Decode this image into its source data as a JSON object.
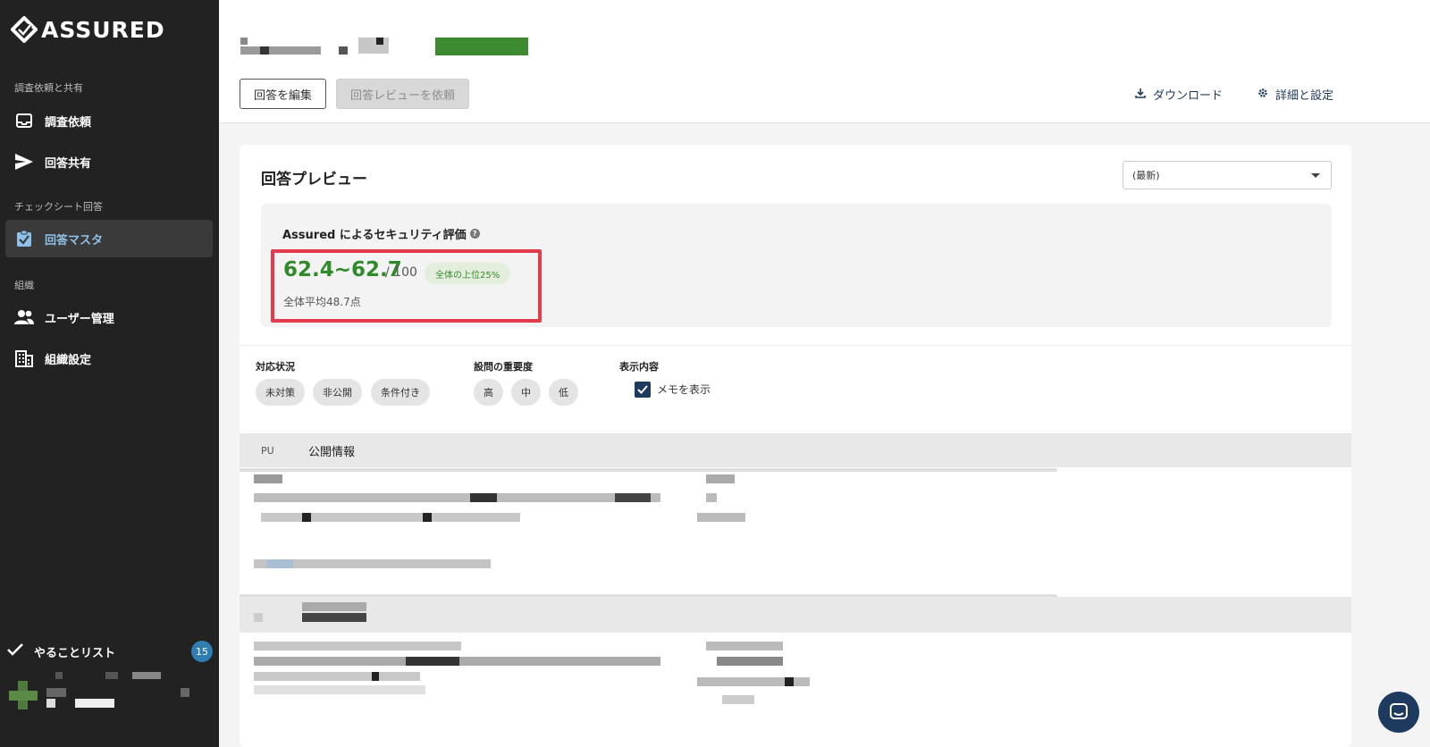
{
  "app": {
    "logo_text": "ASSURED"
  },
  "sidebar": {
    "sections": [
      {
        "label": "調査依頼と共有"
      },
      {
        "label": "チェックシート回答"
      },
      {
        "label": "組織"
      }
    ],
    "items": [
      {
        "label": "調査依頼",
        "icon": "inbox-icon"
      },
      {
        "label": "回答共有",
        "icon": "send-icon"
      },
      {
        "label": "回答マスタ",
        "icon": "clipboard-check-icon",
        "active": true
      },
      {
        "label": "ユーザー管理",
        "icon": "users-icon"
      },
      {
        "label": "組織設定",
        "icon": "building-icon"
      }
    ],
    "todo": {
      "label": "やることリスト",
      "count": "15"
    }
  },
  "header": {
    "edit_button": "回答を編集",
    "review_button": "回答レビューを依頼",
    "download_link": "ダウンロード",
    "settings_link": "詳細と設定"
  },
  "main": {
    "title": "回答プレビュー",
    "version_select": "(最新)",
    "score": {
      "heading": "Assured によるセキュリティ評価",
      "value": "62.4~62.7",
      "denominator": "/ 100",
      "rank_badge": "全体の上位25%",
      "average": "全体平均48.7点"
    },
    "filters": {
      "status": {
        "label": "対応状況",
        "chips": [
          "未対策",
          "非公開",
          "条件付き"
        ]
      },
      "importance": {
        "label": "設問の重要度",
        "chips": [
          "高",
          "中",
          "低"
        ]
      },
      "display": {
        "label": "表示内容",
        "checkbox_label": "メモを表示",
        "checked": true
      }
    },
    "section": {
      "code": "PU",
      "name": "公開情報"
    }
  },
  "colors": {
    "sidebar_bg": "#222222",
    "active_text": "#8fc1e8",
    "score_green": "#2f8a2a",
    "highlight_red": "#e53a49",
    "primary_navy": "#1f3a5f",
    "badge_blue": "#2f7db1"
  }
}
